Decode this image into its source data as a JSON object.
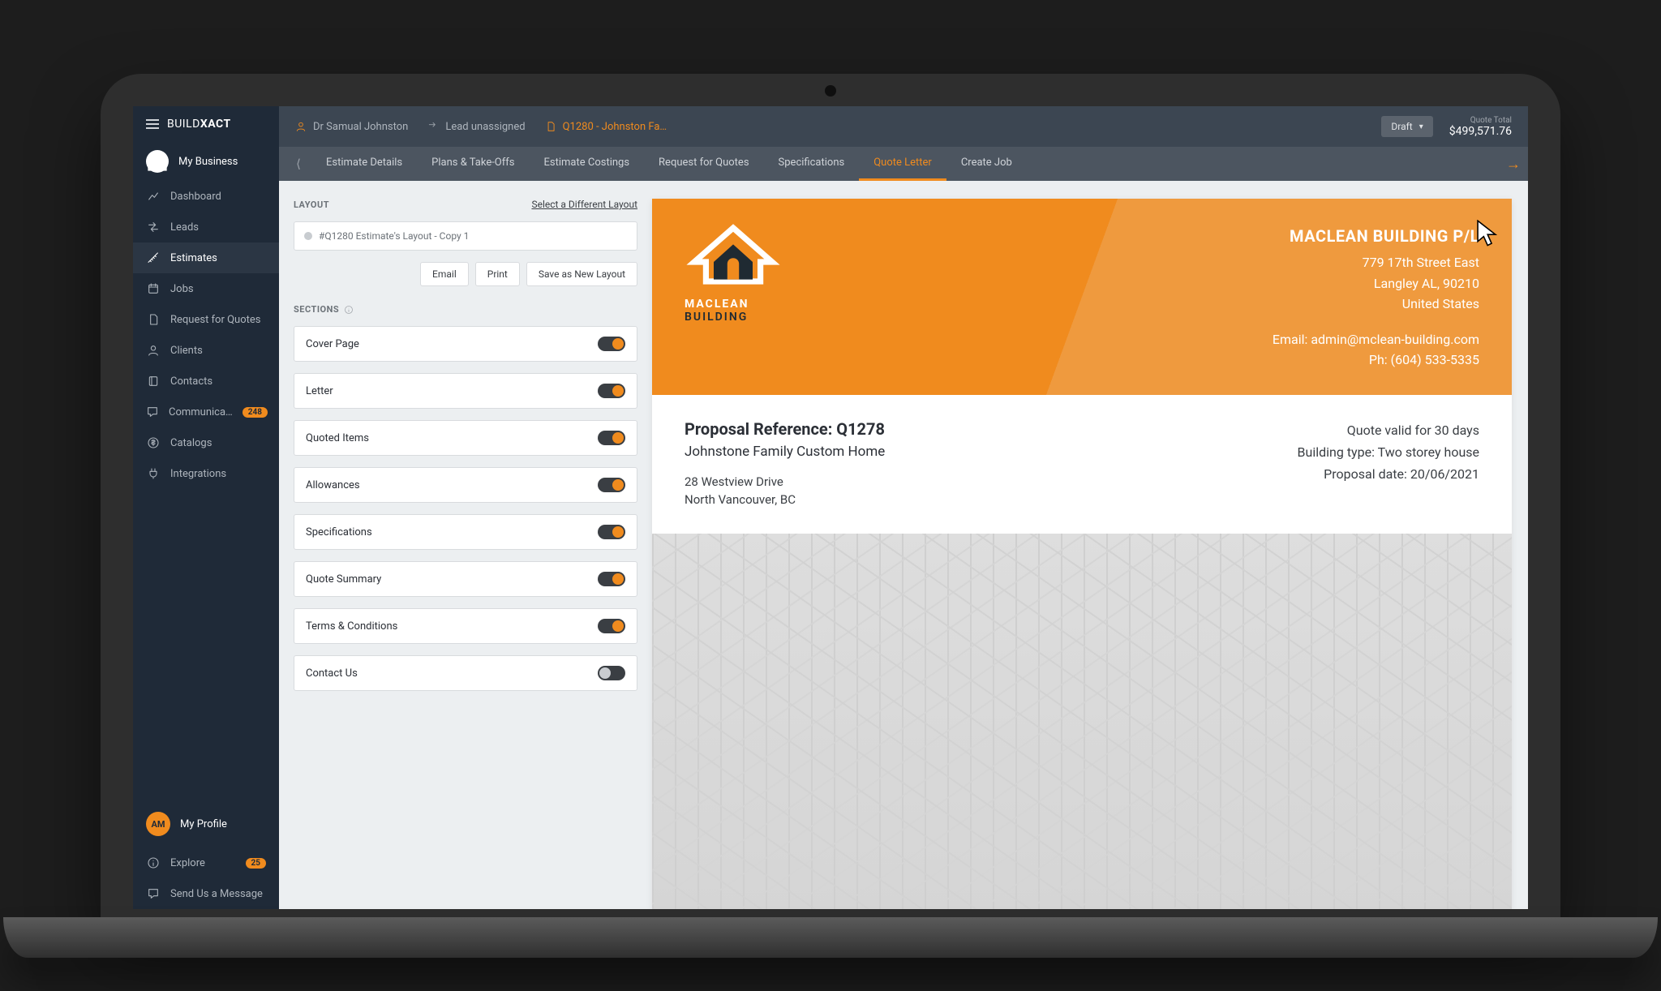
{
  "brand": {
    "a": "BUILD",
    "b": "XACT"
  },
  "sidebar": {
    "top": "My Business",
    "items": [
      {
        "label": "Dashboard"
      },
      {
        "label": "Leads"
      },
      {
        "label": "Estimates"
      },
      {
        "label": "Jobs"
      },
      {
        "label": "Request for Quotes"
      },
      {
        "label": "Clients"
      },
      {
        "label": "Contacts"
      },
      {
        "label": "Communica…",
        "badge": "248"
      },
      {
        "label": "Catalogs"
      },
      {
        "label": "Integrations"
      }
    ],
    "profile": {
      "initials": "AM",
      "label": "My Profile"
    },
    "bottom": [
      {
        "label": "Explore",
        "badge": "25"
      },
      {
        "label": "Send Us a Message"
      }
    ]
  },
  "header": {
    "crumbs": {
      "contact_label": "Dr Samual Johnston",
      "lead_label": "Lead unassigned",
      "quote_label": "Q1280 - Johnston Fa…"
    },
    "status": "Draft",
    "total_label": "Quote Total",
    "total_value": "$499,571.76"
  },
  "tabs": {
    "items": [
      "Estimate Details",
      "Plans & Take-Offs",
      "Estimate Costings",
      "Request for Quotes",
      "Specifications",
      "Quote Letter",
      "Create Job"
    ],
    "active_index": 5
  },
  "config": {
    "layout_heading": "LAYOUT",
    "select_link": "Select a Different Layout",
    "layout_name": "#Q1280 Estimate's Layout - Copy 1",
    "buttons": {
      "email": "Email",
      "print": "Print",
      "save": "Save as New Layout"
    },
    "sections_heading": "SECTIONS",
    "sections": [
      {
        "label": "Cover Page",
        "on": true
      },
      {
        "label": "Letter",
        "on": true
      },
      {
        "label": "Quoted Items",
        "on": true
      },
      {
        "label": "Allowances",
        "on": true
      },
      {
        "label": "Specifications",
        "on": true
      },
      {
        "label": "Quote Summary",
        "on": true
      },
      {
        "label": "Terms & Conditions",
        "on": true
      },
      {
        "label": "Contact Us",
        "on": false
      }
    ]
  },
  "preview": {
    "logo_line1": "MACLEAN",
    "logo_line2": "BUILDING",
    "company": {
      "name": "MACLEAN BUILDING P/L",
      "line1": "779 17th Street East",
      "line2": "Langley AL, 90210",
      "line3": "United States",
      "email": "Email: admin@mclean-building.com",
      "phone": "Ph: (604) 533-5335"
    },
    "proposal": {
      "ref": "Proposal Reference: Q1278",
      "subtitle": "Johnstone Family Custom Home",
      "addr1": "28 Westview Drive",
      "addr2": "North Vancouver, BC",
      "valid": "Quote valid for 30 days",
      "type": "Building type: Two storey house",
      "date": "Proposal date: 20/06/2021"
    }
  }
}
